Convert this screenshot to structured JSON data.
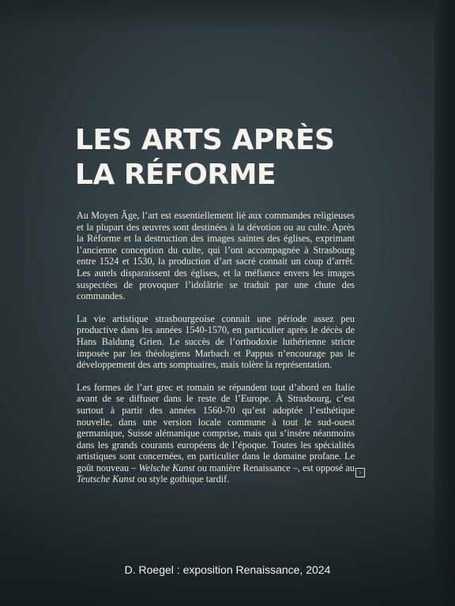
{
  "panel": {
    "title_line1": "LES ARTS APRÈS",
    "title_line2": "LA RÉFORME",
    "paragraphs": {
      "p1": "Au Moyen Âge, l’art est essentiellement lié aux commandes religieuses et la plupart des œuvres sont destinées à la dévotion ou au culte. Après la Réforme et la destruction des images saintes des églises, exprimant l’ancienne conception du culte, qui l’ont accompagnée à Strasbourg entre 1524 et 1530, la production d’art sacré connait un coup d’arrêt. Les autels disparaissent des églises, et la méfiance envers les images suspectées de provoquer l’idolâtrie se traduit par une chute des commandes.",
      "p2": "La vie artistique strasbourgeoise connait une période assez peu productive dans les années 1540-1570, en particulier après le décès de Hans Baldung Grien. Le succès de l’orthodoxie luthérienne stricte imposée par les théologiens Marbach et Pappus n’encourage pas le développement des arts somptuaires, mais tolère la représentation.",
      "p3_part1": "Les formes de l’art grec et romain se répandent tout d’abord en Italie avant de se diffuser dans le reste de l’Europe. À Strasbourg, c’est surtout à partir des années 1560-70 qu’est adoptée l’esthétique nouvelle, dans une version locale commune à tout le sud-ouest germanique, Suisse alémanique comprise, mais qui s’insère néanmoins dans les grands courants européens de l’époque. Toutes les spécialités artistiques sont concernées, en particulier dans le domaine profane. Le goût nouveau – ",
      "p3_em1": "Welsche Kunst",
      "p3_part2": " ou manière Renaissance –, est opposé au ",
      "p3_em2": "Teutsche Kunst",
      "p3_part3": " ou style gothique tardif."
    },
    "arrow_glyph": "›"
  },
  "caption": "D. Roegel : exposition Renaissance, 2024",
  "colors": {
    "panel_background": "#323d41",
    "text": "#ece9df"
  }
}
